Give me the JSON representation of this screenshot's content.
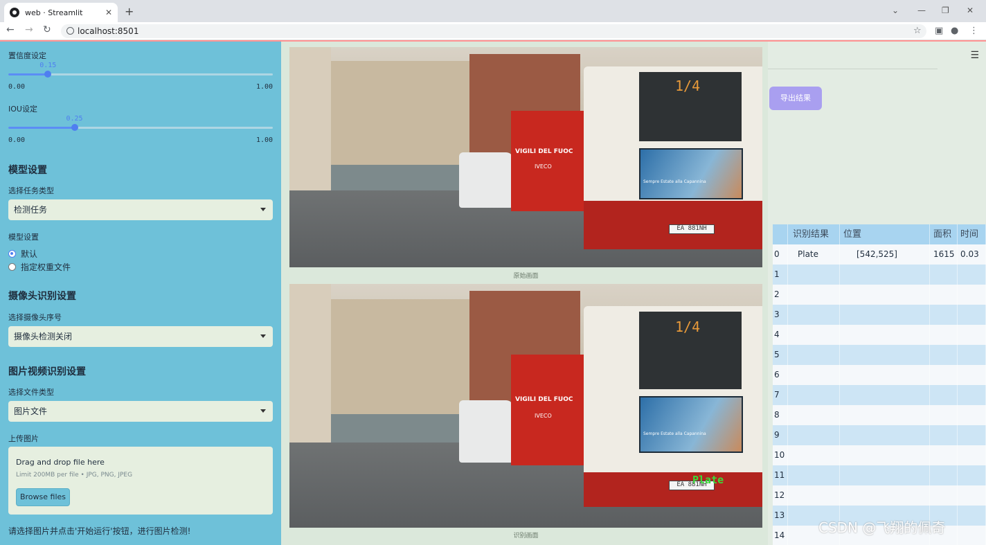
{
  "browser": {
    "tab_title": "web · Streamlit",
    "url": "localhost:8501"
  },
  "sidebar": {
    "confidence_label": "置信度设定",
    "confidence": {
      "value": "0.15",
      "min": "0.00",
      "max": "1.00",
      "fraction": 0.15
    },
    "iou_label": "IOU设定",
    "iou": {
      "value": "0.25",
      "min": "0.00",
      "max": "1.00",
      "fraction": 0.25
    },
    "model_section": "模型设置",
    "task_type_label": "选择任务类型",
    "task_type_value": "检测任务",
    "model_config_label": "模型设置",
    "radio_default": "默认",
    "radio_custom": "指定权重文件",
    "camera_section": "摄像头识别设置",
    "camera_select_label": "选择摄像头序号",
    "camera_select_value": "摄像头检测关闭",
    "media_section": "图片视频识别设置",
    "file_type_label": "选择文件类型",
    "file_type_value": "图片文件",
    "upload_label": "上传图片",
    "upload_title": "Drag and drop file here",
    "upload_limit": "Limit 200MB per file • JPG, PNG, JPEG",
    "browse_button": "Browse files",
    "note": "请选择图片并点击'开始运行'按钮，进行图片检测!"
  },
  "main": {
    "original_caption": "原始画面",
    "result_caption": "识别画面",
    "detection_label": "Plate",
    "bus_route": "1/4",
    "plate_text": "EA 881NH",
    "truck_text": "VIGILI DEL FUOC",
    "truck_brand": "IVECO",
    "ad_text": "Sempre Estate alla Capannina"
  },
  "right": {
    "export_button": "导出结果",
    "table": {
      "headers": [
        "",
        "识别结果",
        "位置",
        "面积",
        "时间"
      ],
      "rows": [
        [
          "0",
          "Plate",
          "[542,525]",
          "1615",
          "0.03"
        ],
        [
          "1",
          "",
          "",
          "",
          ""
        ],
        [
          "2",
          "",
          "",
          "",
          ""
        ],
        [
          "3",
          "",
          "",
          "",
          ""
        ],
        [
          "4",
          "",
          "",
          "",
          ""
        ],
        [
          "5",
          "",
          "",
          "",
          ""
        ],
        [
          "6",
          "",
          "",
          "",
          ""
        ],
        [
          "7",
          "",
          "",
          "",
          ""
        ],
        [
          "8",
          "",
          "",
          "",
          ""
        ],
        [
          "9",
          "",
          "",
          "",
          ""
        ],
        [
          "10",
          "",
          "",
          "",
          ""
        ],
        [
          "11",
          "",
          "",
          "",
          ""
        ],
        [
          "12",
          "",
          "",
          "",
          ""
        ],
        [
          "13",
          "",
          "",
          "",
          ""
        ],
        [
          "14",
          "",
          "",
          "",
          ""
        ]
      ]
    }
  },
  "watermark": "CSDN @飞翔的佩奇",
  "colors": {
    "sidebar": "#6ec1d9",
    "accent": "#4f7ff0",
    "export": "#a99ff0",
    "detection": "#3adb3a"
  }
}
